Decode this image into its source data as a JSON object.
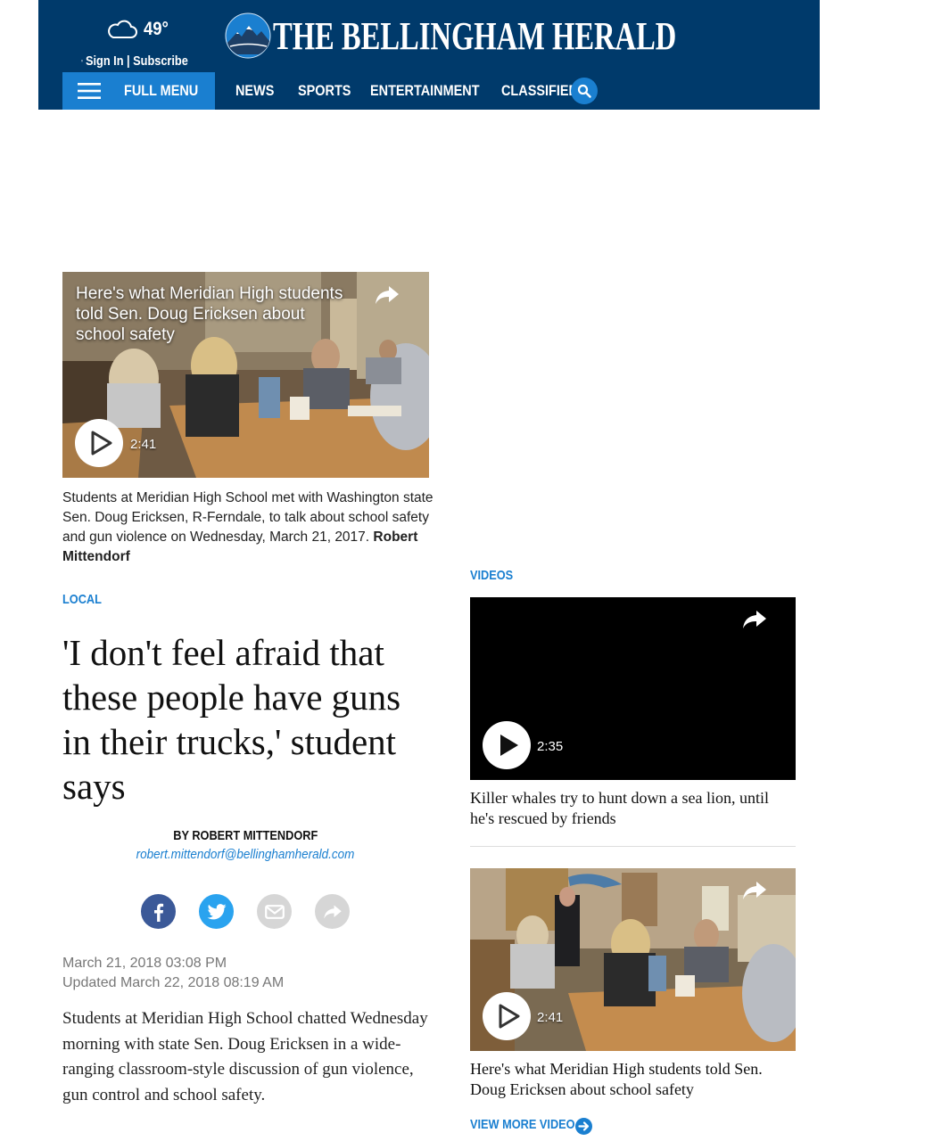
{
  "header": {
    "weather_temp": "49°",
    "weather_icon": "cloud-icon",
    "account_link": "Sign In | Subscribe",
    "logo_text": "THE BELLINGHAM HERALD",
    "menu_label": "FULL MENU",
    "nav_links": [
      "NEWS",
      "SPORTS",
      "ENTERTAINMENT",
      "CLASSIFIEDS"
    ],
    "search_icon": "search-icon",
    "background_color": "#003a6b",
    "accent_color": "#1a7fd0"
  },
  "lead_video": {
    "overlay_title": "Here's what Meridian High students told Sen. Doug Ericksen about school safety",
    "duration": "2:41",
    "caption": "Students at Meridian High School met with Washington state Sen. Doug Ericksen, R-Ferndale, to talk about school safety and gun violence on Wednesday, March 21, 2017.",
    "caption_credit": "Robert Mittendorf"
  },
  "article": {
    "section": "LOCAL",
    "headline": "'I don't feel afraid that these people have guns in their trucks,' student says",
    "byline": "BY ROBERT MITTENDORF",
    "email": "robert.mittendorf@bellinghamherald.com",
    "share_icons": [
      "facebook-icon",
      "twitter-icon",
      "email-icon",
      "share-icon"
    ],
    "published": "March 21, 2018 03:08 PM",
    "updated": "Updated March 22, 2018 08:19 AM",
    "body": "Students at Meridian High School chatted Wednesday morning with state Sen. Doug Ericksen in a wide-ranging classroom-style discussion of gun violence, gun control and school safety."
  },
  "videos_rail": {
    "label": "VIDEOS",
    "items": [
      {
        "title": "Killer whales try to hunt down a sea lion, until he's rescued by friends",
        "duration": "2:35"
      },
      {
        "title": "Here's what Meridian High students told Sen. Doug Ericksen about school safety",
        "duration": "2:41"
      }
    ],
    "view_more": "VIEW MORE VIDEO"
  }
}
